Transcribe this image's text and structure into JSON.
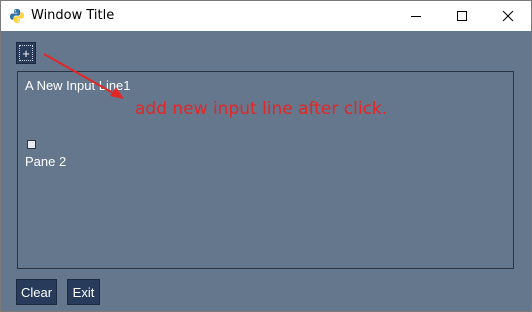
{
  "window": {
    "title": "Window Title",
    "icon": "python-icon",
    "controls": [
      "minimize-icon",
      "maximize-icon",
      "close-icon"
    ]
  },
  "toolbar": {
    "add_label": "+"
  },
  "pane": {
    "input_line_1": "A New Input Line1",
    "pane2_label": "Pane 2"
  },
  "footer": {
    "clear_label": "Clear",
    "exit_label": "Exit"
  },
  "annotation": {
    "text": "add new input line after click.",
    "color": "#e32626"
  },
  "colors": {
    "background": "#64778d",
    "button": "#283b5b",
    "text": "#ffffff"
  }
}
